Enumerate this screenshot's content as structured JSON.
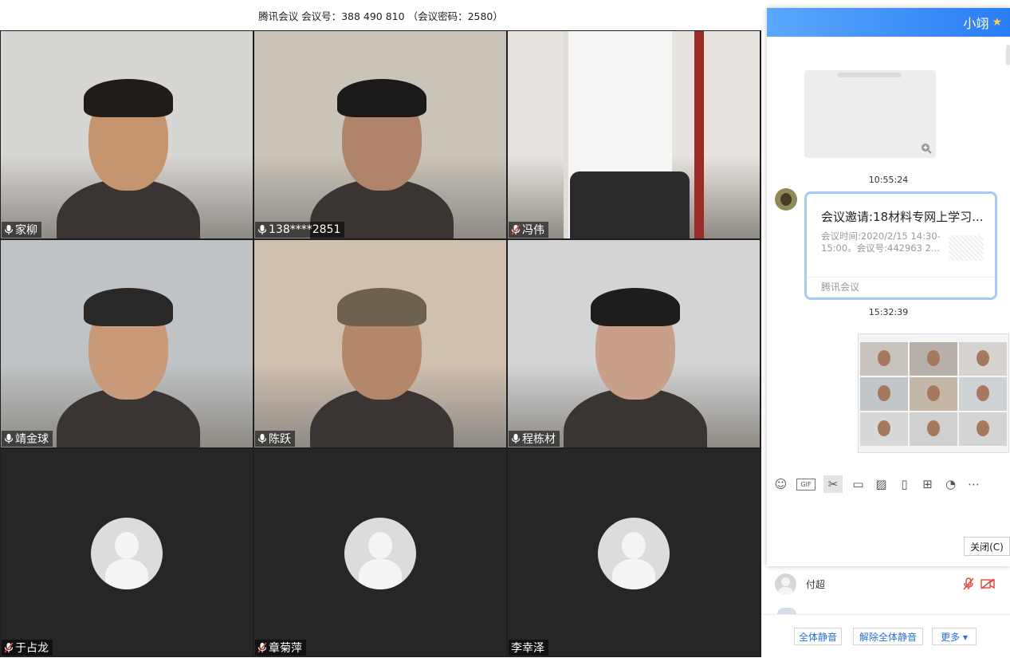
{
  "title_bar": {
    "text": "腾讯会议 会议号：388 490 810 （会议密码：2580）"
  },
  "participants": [
    {
      "name": "家柳",
      "mic": "on",
      "video": true,
      "bg": "#d8d6d3",
      "face": "#c4956e",
      "hair": "#1f1c1a"
    },
    {
      "name": "138****2851",
      "mic": "on",
      "video": true,
      "bg": "#c9c3b8",
      "face": "#b0846a",
      "hair": "#1b1a19"
    },
    {
      "name": "冯伟",
      "mic": "muted",
      "video": true,
      "bg": "#e7e3de",
      "face": null,
      "hair": null
    },
    {
      "name": "靖金球",
      "mic": "on",
      "video": true,
      "bg": "#bfc3c5",
      "face": "#c99a7a",
      "hair": "#2a2827"
    },
    {
      "name": "陈跃",
      "mic": "on",
      "video": true,
      "bg": "#cfc0b0",
      "face": "#b5876a",
      "hair": "#6d6250"
    },
    {
      "name": "程栋材",
      "mic": "on",
      "video": true,
      "bg": "#d2d4d6",
      "face": "#c8a08a",
      "hair": "#1e1d1c"
    },
    {
      "name": "于占龙",
      "mic": "muted",
      "video": false
    },
    {
      "name": "章菊萍",
      "mic": "muted",
      "video": false
    },
    {
      "name": "李幸泽",
      "mic": "none",
      "video": false
    }
  ],
  "chat": {
    "header_name": "小翊",
    "timestamps": [
      "10:55:24",
      "15:32:39"
    ],
    "invite_card": {
      "title": "会议邀请:18材料专网上学习...",
      "body": "会议时间:2020/2/15 14:30-15:00。会议号:442963 2...",
      "footer": "腾讯会议"
    },
    "toolbar_icons": [
      "emoji-icon",
      "gif-icon",
      "scissors-icon",
      "folder-icon",
      "image-icon",
      "shake-icon",
      "bag-icon",
      "circle-arrow-icon",
      "more-icon"
    ],
    "close_label": "关闭(C)"
  },
  "member_row": {
    "name": "付超"
  },
  "bottom_buttons": {
    "mute_all": "全体静音",
    "unmute_all": "解除全体静音",
    "more": "更多 ▾"
  },
  "colors": {
    "chat_header_start": "#5aa8ff",
    "chat_header_end": "#2a7df5",
    "muted_red": "#e0463a",
    "link_blue": "#2a6fd6"
  }
}
